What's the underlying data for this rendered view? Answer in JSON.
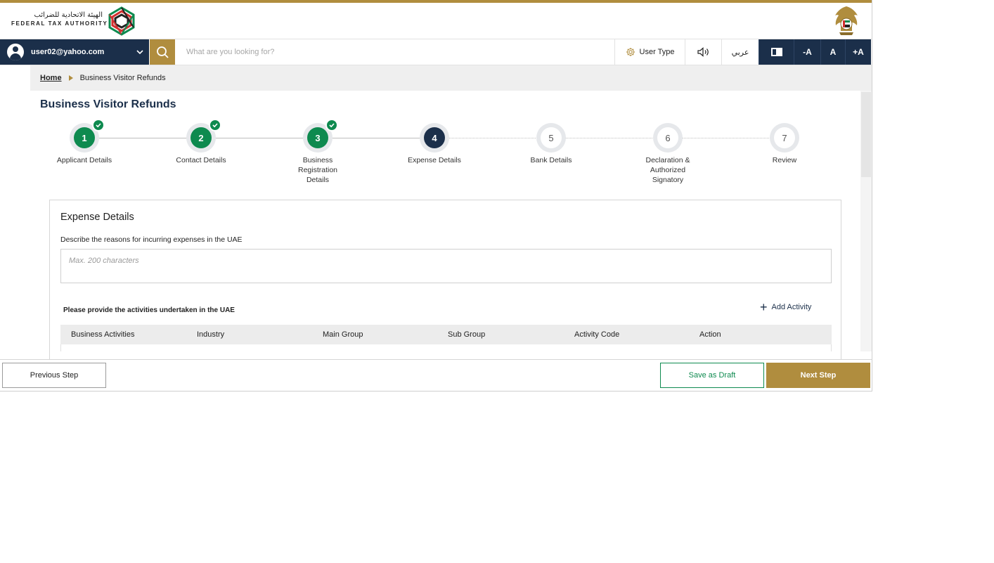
{
  "header": {
    "logo_arabic": "الهيئة الاتحادية للضرائب",
    "logo_english": "FEDERAL TAX AUTHORITY"
  },
  "toolbar": {
    "user_email": "user02@yahoo.com",
    "search_placeholder": "What are you looking for?",
    "user_type_label": "User Type",
    "language_label": "عربي",
    "font_decrease_label": "-A",
    "font_normal_label": "A",
    "font_increase_label": "+A"
  },
  "breadcrumb": {
    "home": "Home",
    "current": "Business Visitor Refunds"
  },
  "page": {
    "title": "Business Visitor Refunds"
  },
  "stepper": {
    "steps": [
      {
        "number": "1",
        "label": "Applicant Details",
        "status": "done"
      },
      {
        "number": "2",
        "label": "Contact Details",
        "status": "done"
      },
      {
        "number": "3",
        "label": "Business Registration Details",
        "status": "done"
      },
      {
        "number": "4",
        "label": "Expense Details",
        "status": "active"
      },
      {
        "number": "5",
        "label": "Bank Details",
        "status": "todo"
      },
      {
        "number": "6",
        "label": "Declaration & Authorized Signatory",
        "status": "todo"
      },
      {
        "number": "7",
        "label": "Review",
        "status": "todo"
      }
    ]
  },
  "expense": {
    "title": "Expense Details",
    "reason_label": "Describe the reasons for incurring expenses in the UAE",
    "reason_placeholder": "Max. 200 characters",
    "reason_value": "",
    "activities_label": "Please provide the activities undertaken in the UAE",
    "add_activity_label": "Add Activity",
    "table_headers": [
      "Business Activities",
      "Industry",
      "Main Group",
      "Sub Group",
      "Activity Code",
      "Action"
    ]
  },
  "footer": {
    "previous_label": "Previous Step",
    "draft_label": "Save as Draft",
    "next_label": "Next Step"
  },
  "colors": {
    "navy": "#1b2f4a",
    "gold": "#b08d3e",
    "green": "#0e8a4f"
  }
}
